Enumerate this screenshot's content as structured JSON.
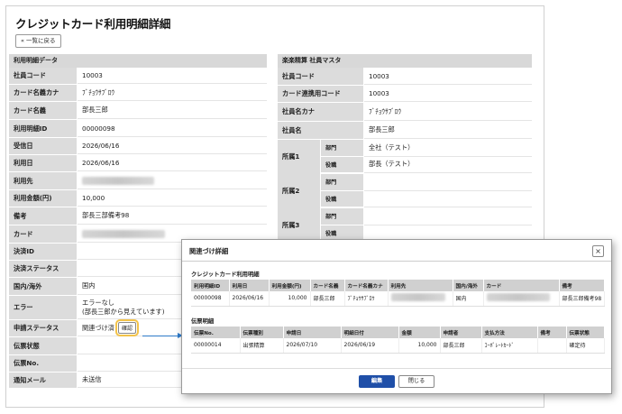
{
  "page": {
    "title": "クレジットカード利用明細詳細",
    "back_label": "« 一覧に戻る"
  },
  "detail": {
    "header": "利用明細データ",
    "rows": [
      {
        "label": "社員コード",
        "value": "10003"
      },
      {
        "label": "カード名義カナ",
        "value": "ﾌﾞﾁｮｳｻﾌﾞﾛｳ"
      },
      {
        "label": "カード名義",
        "value": "部長三郎"
      },
      {
        "label": "利用明細ID",
        "value": "00000098"
      },
      {
        "label": "受信日",
        "value": "2026/06/16"
      },
      {
        "label": "利用日",
        "value": "2026/06/16"
      },
      {
        "label": "利用先",
        "value": ""
      },
      {
        "label": "利用金額(円)",
        "value": "10,000"
      },
      {
        "label": "備考",
        "value": "部長三部備考98"
      },
      {
        "label": "カード",
        "value": ""
      },
      {
        "label": "決済ID",
        "value": ""
      },
      {
        "label": "決済ステータス",
        "value": ""
      },
      {
        "label": "国内/海外",
        "value": "国内"
      },
      {
        "label": "エラー",
        "value": "エラーなし",
        "value2": "(部長三郎から見えています)"
      },
      {
        "label": "申請ステータス",
        "value": "関連づけ済",
        "button": "確認"
      },
      {
        "label": "伝票状態",
        "value": ""
      },
      {
        "label": "伝票No.",
        "value": ""
      },
      {
        "label": "通知メール",
        "value": "未送信"
      }
    ]
  },
  "master": {
    "header": "楽楽精算 社員マスタ",
    "rows": [
      {
        "label": "社員コード",
        "value": "10003"
      },
      {
        "label": "カード連携用コード",
        "value": "10003"
      },
      {
        "label": "社員名カナ",
        "value": "ﾌﾞﾁｮｳｻﾌﾞﾛｳ"
      },
      {
        "label": "社員名",
        "value": "部長三郎"
      }
    ],
    "affiliations": [
      {
        "label": "所属1",
        "dept_label": "部門",
        "dept": "全社（テスト）",
        "role_label": "役職",
        "role": "部長（テスト）"
      },
      {
        "label": "所属2",
        "dept_label": "部門",
        "dept": "",
        "role_label": "役職",
        "role": ""
      },
      {
        "label": "所属3",
        "dept_label": "部門",
        "dept": "",
        "role_label": "役職",
        "role": ""
      }
    ]
  },
  "modal": {
    "title": "関連づけ詳細",
    "close_icon": "×",
    "card_section": "クレジットカード利用明細",
    "card_columns": [
      "利用明細ID",
      "利用日",
      "利用金額(円)",
      "カード名義",
      "カード名義カナ",
      "利用先",
      "国内/海外",
      "カード",
      "備考"
    ],
    "card_rows": [
      [
        "00000098",
        "2026/06/16",
        "10,000",
        "部長三郎",
        "ﾌﾞﾁｮｳｻﾌﾞﾛｳ",
        "",
        "国内",
        "",
        "部長三郎備考98"
      ]
    ],
    "slip_section": "伝票明細",
    "slip_columns": [
      "伝票No.",
      "伝票種別",
      "申請日",
      "明細日付",
      "金額",
      "申請者",
      "支払方法",
      "備考",
      "伝票状態"
    ],
    "slip_rows": [
      [
        "00000014",
        "出張精算",
        "2026/07/10",
        "2026/06/19",
        "10,000",
        "部長三郎",
        "ｺｰﾎﾟﾚｰﾄｶｰﾄﾞ",
        "",
        "確定待"
      ]
    ],
    "edit_label": "編集",
    "close_label": "閉じる"
  }
}
